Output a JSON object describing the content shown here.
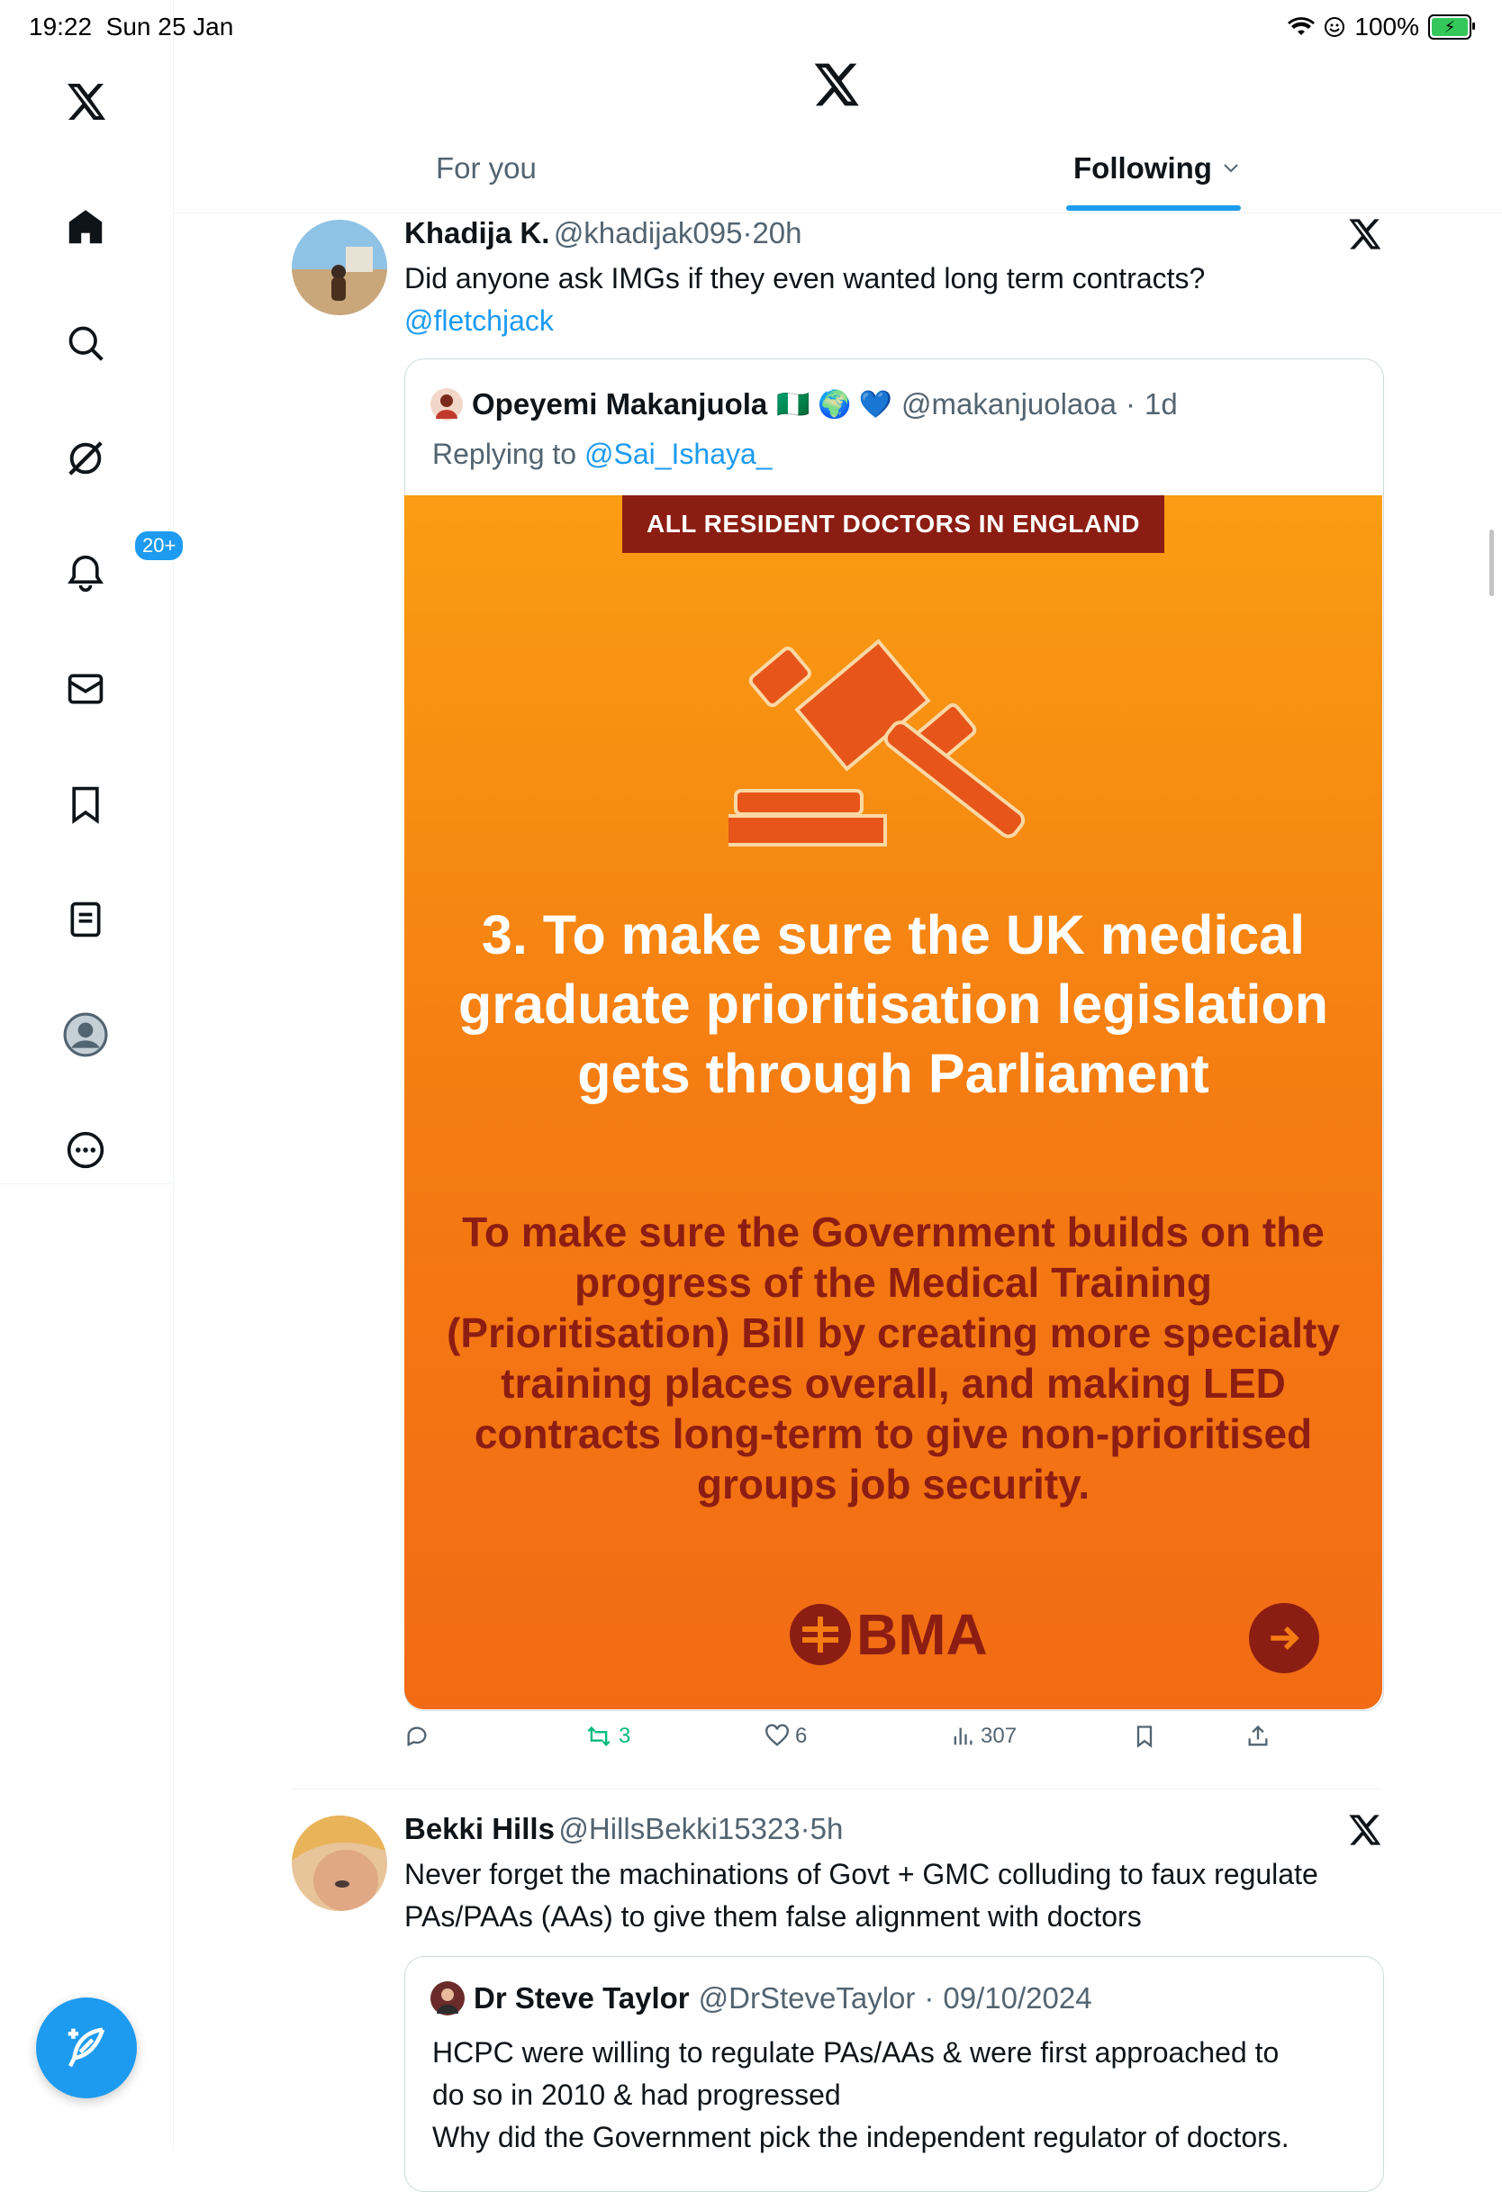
{
  "status_bar": {
    "time": "19:22",
    "date": "Sun 25 Jan",
    "battery": "100%"
  },
  "sidebar": {
    "notifications_badge": "20+"
  },
  "tabs": [
    {
      "label": "For you",
      "active": false
    },
    {
      "label": "Following",
      "active": true
    }
  ],
  "post1": {
    "name": "Khadija K.",
    "handle": "@khadijak095",
    "sep": "·",
    "time": "20h",
    "text": "Did anyone ask IMGs if they even wanted long term contracts?",
    "mention": "@fletchjack",
    "quote": {
      "name": "Opeyemi Makanjuola",
      "emoji": "🇳🇬 🌍 💙",
      "handle": "@makanjuolaoa",
      "time": "1d",
      "replying_label": "Replying to",
      "replying_to": "@Sai_Ishaya_",
      "poster": {
        "banner": "ALL RESIDENT DOCTORS IN ENGLAND",
        "headline": "3. To make sure the UK medical graduate prioritisation legislation gets through Parliament",
        "subtext": "To make sure the Government builds on the progress of the Medical Training (Prioritisation) Bill by creating more specialty training places overall, and making LED contracts long-term to give non-prioritised groups job security.",
        "logo": "BMA"
      }
    },
    "actions": {
      "reposts": "3",
      "likes": "6",
      "views": "307"
    }
  },
  "post2": {
    "name": "Bekki Hills",
    "handle": "@HillsBekki15323",
    "sep": "·",
    "time": "5h",
    "text": "Never forget the machinations of Govt + GMC colluding to faux regulate PAs/PAAs (AAs) to give them false alignment with doctors",
    "quote": {
      "name": "Dr Steve Taylor",
      "handle": "@DrSteveTaylor",
      "time": "09/10/2024",
      "text_lines": [
        "HCPC were willing to regulate PAs/AAs & were first approached to",
        "do so in 2010 & had progressed",
        "Why did the Government pick the independent regulator of doctors."
      ]
    }
  },
  "colors": {
    "accent": "#1d9bf0",
    "repost": "#00ba7c",
    "poster_orange": "#f57c12",
    "poster_red": "#8c1d12"
  }
}
